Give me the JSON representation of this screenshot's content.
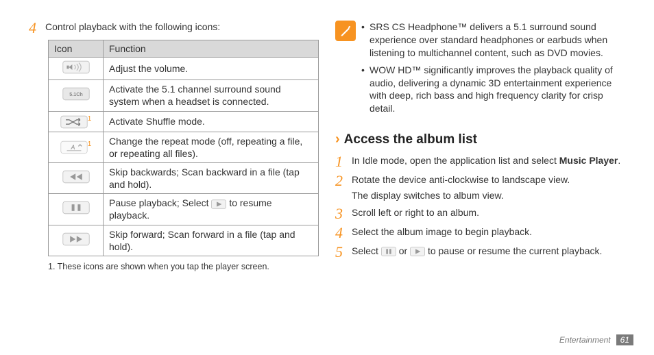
{
  "left": {
    "step4_num": "4",
    "step4_text": "Control playback with the following icons:",
    "table": {
      "headers": {
        "icon": "Icon",
        "function": "Function"
      },
      "rows": [
        {
          "fn": "Adjust the volume."
        },
        {
          "fn": "Activate the 5.1 channel surround sound system when a headset is connected."
        },
        {
          "fn": "Activate Shuffle mode."
        },
        {
          "fn": "Change the repeat mode (off, repeating a file, or repeating all files)."
        },
        {
          "fn": "Skip backwards; Scan backward in a file (tap and hold)."
        },
        {
          "fn_pre": "Pause playback; Select ",
          "fn_post": " to resume playback."
        },
        {
          "fn": "Skip forward; Scan forward in a file (tap and hold)."
        }
      ]
    },
    "footnote": "1. These icons are shown when you tap the player screen."
  },
  "right": {
    "notes": [
      "SRS CS Headphone™ delivers a 5.1 surround sound experience over standard headphones or earbuds when listening to multichannel content, such as DVD movies.",
      "WOW HD™ significantly improves the playback quality of audio, delivering a dynamic 3D entertainment experience with deep, rich bass and high frequency clarity for crisp detail."
    ],
    "section_title": "Access the album list",
    "steps": [
      {
        "num": "1",
        "text_pre": "In Idle mode, open the application list and select ",
        "bold": "Music Player",
        "text_post": "."
      },
      {
        "num": "2",
        "line1": "Rotate the device anti-clockwise to landscape view.",
        "line2": "The display switches to album view."
      },
      {
        "num": "3",
        "text": "Scroll left or right to an album."
      },
      {
        "num": "4",
        "text": "Select the album image to begin playback."
      },
      {
        "num": "5",
        "text_pre": "Select ",
        "text_mid": " or ",
        "text_post": " to pause or resume the current playback."
      }
    ]
  },
  "footer": {
    "section": "Entertainment",
    "page": "61"
  }
}
